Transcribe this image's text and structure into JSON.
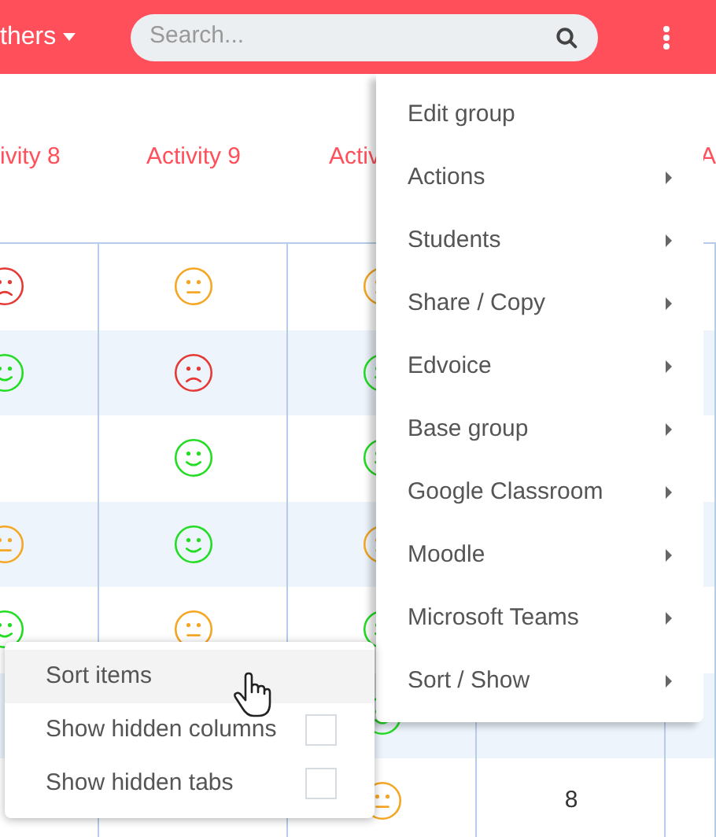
{
  "header": {
    "group_label": "thers",
    "search": {
      "placeholder": "Search..."
    }
  },
  "table": {
    "columns": [
      {
        "label": "ivity 8"
      },
      {
        "label": "Activity 9"
      },
      {
        "label": "Activ"
      },
      {},
      {
        "label": "A"
      }
    ],
    "rows": [
      [
        {
          "kind": "sad"
        },
        {
          "kind": "neutral"
        },
        {
          "kind": "neutral"
        },
        {
          "kind": "empty"
        },
        {
          "kind": "empty"
        }
      ],
      [
        {
          "kind": "happy"
        },
        {
          "kind": "sad"
        },
        {
          "kind": "happy"
        },
        {
          "kind": "empty"
        },
        {
          "kind": "empty"
        }
      ],
      [
        {
          "kind": "empty"
        },
        {
          "kind": "happy"
        },
        {
          "kind": "happy"
        },
        {
          "kind": "empty"
        },
        {
          "kind": "empty"
        }
      ],
      [
        {
          "kind": "neutral"
        },
        {
          "kind": "happy"
        },
        {
          "kind": "neutral"
        },
        {
          "kind": "empty"
        },
        {
          "kind": "empty"
        }
      ],
      [
        {
          "kind": "happy"
        },
        {
          "kind": "neutral"
        },
        {
          "kind": "happy"
        },
        {
          "kind": "empty"
        },
        {
          "kind": "empty"
        }
      ],
      [
        {
          "kind": "empty"
        },
        {
          "kind": "empty"
        },
        {
          "kind": "happy"
        },
        {
          "kind": "empty"
        },
        {
          "kind": "empty"
        }
      ],
      [
        {
          "kind": "empty"
        },
        {
          "kind": "empty"
        },
        {
          "kind": "neutral"
        },
        {
          "kind": "text",
          "text": "8"
        },
        {
          "kind": "empty"
        }
      ]
    ]
  },
  "menu": {
    "items": [
      {
        "label": "Edit group",
        "submenu": false
      },
      {
        "label": "Actions",
        "submenu": true
      },
      {
        "label": "Students",
        "submenu": true
      },
      {
        "label": "Share / Copy",
        "submenu": true
      },
      {
        "label": "Edvoice",
        "submenu": true
      },
      {
        "label": "Base group",
        "submenu": true
      },
      {
        "label": "Google Classroom",
        "submenu": true
      },
      {
        "label": "Moodle",
        "submenu": true
      },
      {
        "label": "Microsoft Teams",
        "submenu": true
      },
      {
        "label": "Sort / Show",
        "submenu": true
      }
    ]
  },
  "sort_menu": {
    "items": [
      {
        "kind": "action",
        "label": "Sort items",
        "selected": true
      },
      {
        "kind": "checkbox",
        "label": "Show hidden columns",
        "checked": false,
        "selected": false
      },
      {
        "kind": "checkbox",
        "label": "Show hidden tabs",
        "checked": false,
        "selected": false
      }
    ]
  }
}
